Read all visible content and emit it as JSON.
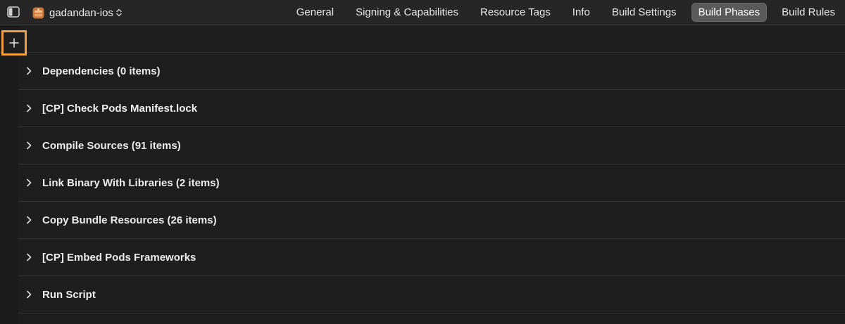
{
  "header": {
    "target_name": "gadandan-ios",
    "target_icon": "app-target-icon",
    "sidebar_toggle_icon": "sidebar-toggle-icon"
  },
  "tabs": [
    {
      "label": "General",
      "selected": false
    },
    {
      "label": "Signing & Capabilities",
      "selected": false
    },
    {
      "label": "Resource Tags",
      "selected": false
    },
    {
      "label": "Info",
      "selected": false
    },
    {
      "label": "Build Settings",
      "selected": false
    },
    {
      "label": "Build Phases",
      "selected": true
    },
    {
      "label": "Build Rules",
      "selected": false
    }
  ],
  "add_button": {
    "icon": "plus-icon",
    "highlight_color": "#f0a042"
  },
  "phases": [
    {
      "label": "Dependencies (0 items)"
    },
    {
      "label": "[CP] Check Pods Manifest.lock"
    },
    {
      "label": "Compile Sources (91 items)"
    },
    {
      "label": "Link Binary With Libraries (2 items)"
    },
    {
      "label": "Copy Bundle Resources (26 items)"
    },
    {
      "label": "[CP] Embed Pods Frameworks"
    },
    {
      "label": "Run Script"
    }
  ]
}
